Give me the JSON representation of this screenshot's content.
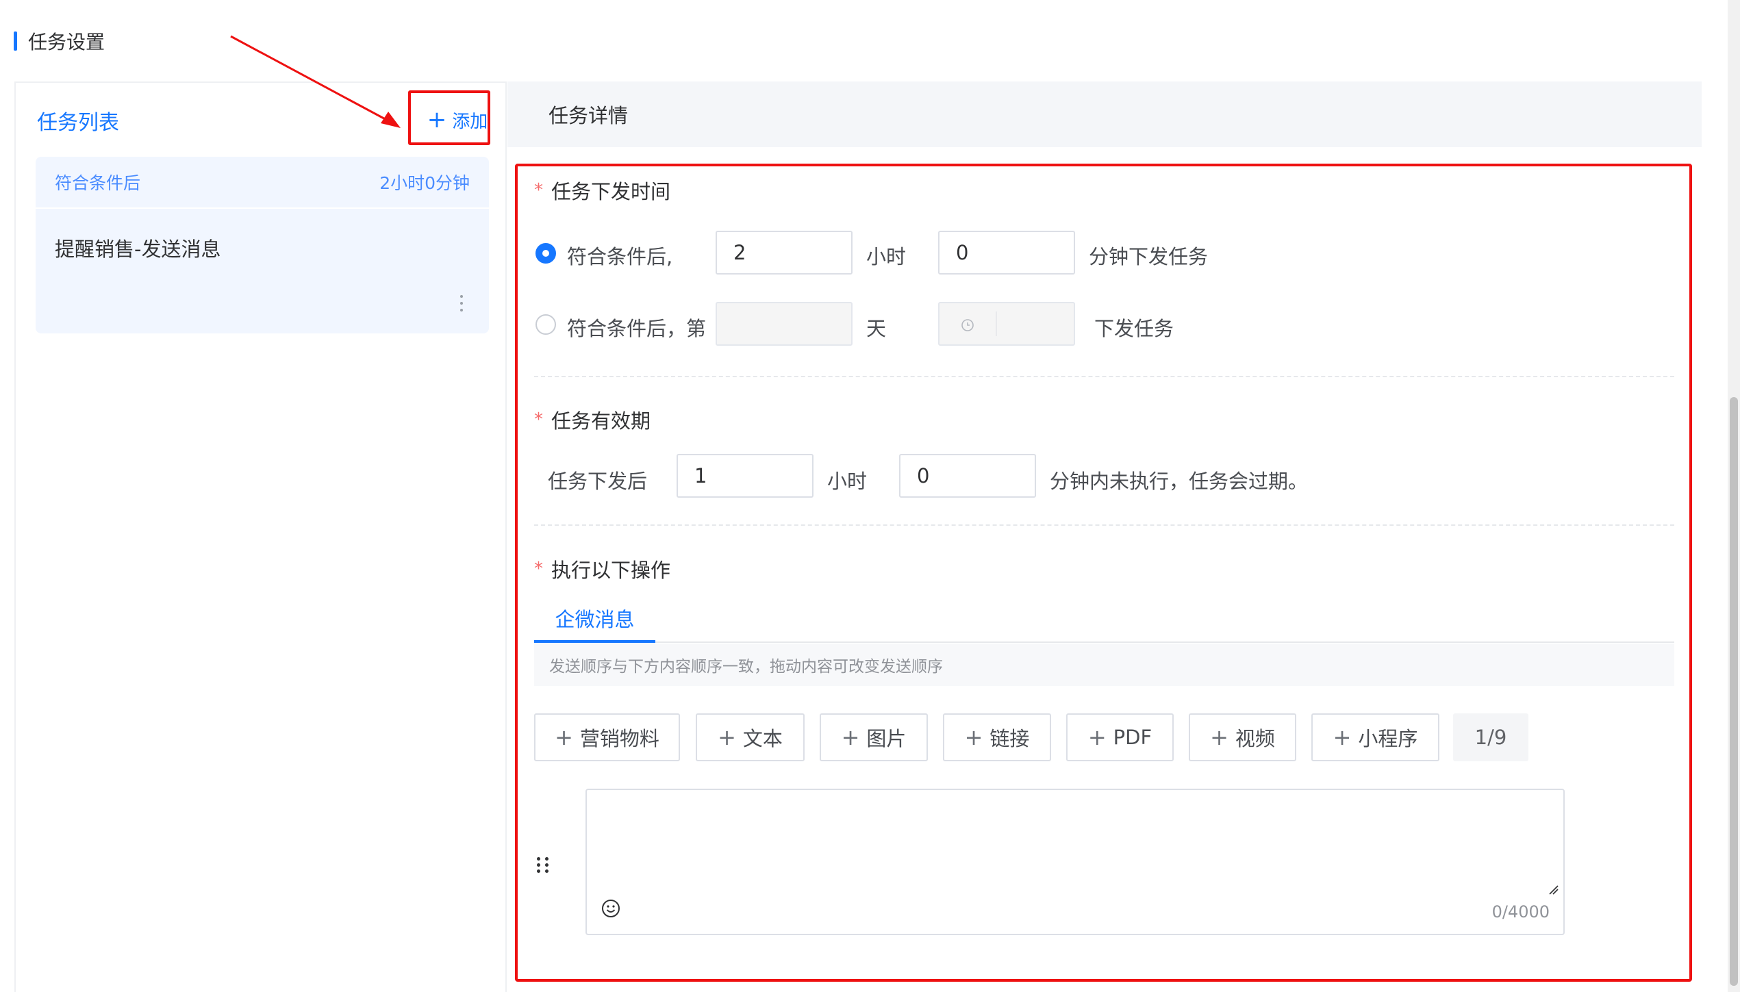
{
  "section": {
    "title": "任务设置"
  },
  "left": {
    "title": "任务列表",
    "add_label": "添加",
    "tasks": [
      {
        "condition": "符合条件后",
        "delay": "2小时0分钟",
        "name": "提醒销售-发送消息"
      }
    ]
  },
  "right": {
    "header": "任务详情",
    "dispatch": {
      "label": "任务下发时间",
      "option1_prefix": "符合条件后,",
      "hours_value": "2",
      "hours_unit": "小时",
      "minutes_value": "0",
      "option1_suffix": "分钟下发任务",
      "option2_prefix": "符合条件后，第",
      "day_value": "",
      "day_unit": "天",
      "option2_suffix": "下发任务"
    },
    "validity": {
      "label": "任务有效期",
      "prefix": "任务下发后",
      "hours_value": "1",
      "hours_unit": "小时",
      "minutes_value": "0",
      "suffix": "分钟内未执行，任务会过期。"
    },
    "actions": {
      "label": "执行以下操作",
      "tab": "企微消息",
      "hint": "发送顺序与下方内容顺序一致，拖动内容可改变发送顺序",
      "buttons": [
        "营销物料",
        "文本",
        "图片",
        "链接",
        "PDF",
        "视频",
        "小程序"
      ],
      "count": "1/9",
      "textarea_value": "",
      "char_counter": "0/4000"
    }
  },
  "colors": {
    "accent": "#1677ff",
    "annotation": "#ee1111",
    "required": "#f56c6c"
  },
  "icons": [
    "plus-icon",
    "more-vertical-icon",
    "clock-icon",
    "drag-handle-icon",
    "emoji-icon",
    "annotation-arrow"
  ]
}
